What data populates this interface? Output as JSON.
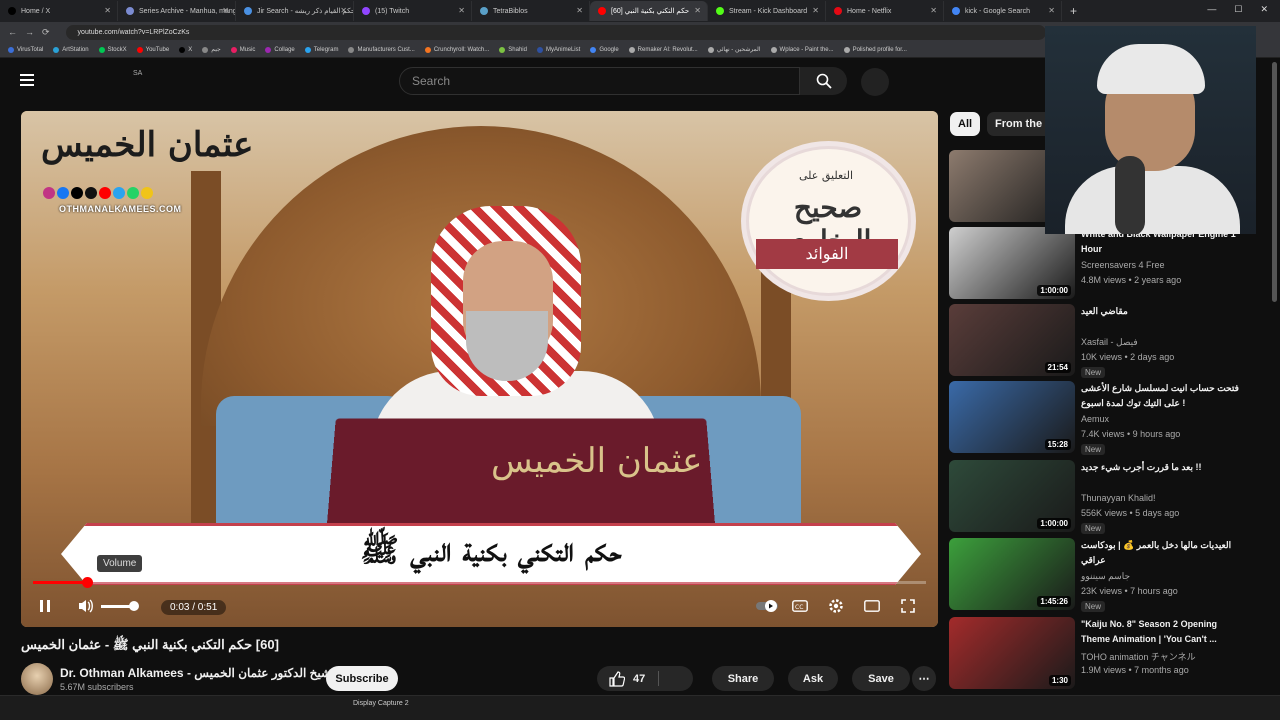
{
  "browser": {
    "tabs": [
      {
        "label": "Home / X",
        "color": "#000000"
      },
      {
        "label": "Series Archive - Manhua, mang",
        "color": "#7b8bd1"
      },
      {
        "label": "Jir Search - حكم القيام ذكر ريشه",
        "color": "#4a90e2"
      },
      {
        "label": "(15) Twitch",
        "color": "#9146ff"
      },
      {
        "label": "TetraBiblos",
        "color": "#5aa0c8"
      },
      {
        "label": "حكم التكني بكنية النبي [60]",
        "color": "#ff0000",
        "active": true
      },
      {
        "label": "Stream - Kick Dashboard",
        "color": "#53fc18"
      },
      {
        "label": "Home - Netflix",
        "color": "#e50914"
      },
      {
        "label": "kick - Google Search",
        "color": "#4285f4"
      }
    ],
    "new_tab": "+",
    "url": "youtube.com/watch?v=LRPlZoCzKs",
    "bookmarks": [
      "VirusTotal",
      "ArtStation",
      "StockX",
      "YouTube",
      "X",
      "جيم",
      "Music",
      "Collage",
      "Telegram",
      "Manufacturers Cust...",
      "Crunchyroll: Watch...",
      "Shahid",
      "MyAnimeList",
      "Google",
      "Remaker AI: Revolut...",
      "المرشحين - نهائي",
      "Wplace - Paint the...",
      "Polished profile for..."
    ]
  },
  "header": {
    "country": "SA",
    "search_placeholder": "Search"
  },
  "video": {
    "logo_text": "عثمان الخميس",
    "logo_url": "OTHMANALKAMEES.COM",
    "badge_small": "التعليق على",
    "badge_title": "صحيح البخاري",
    "badge_ribbon": "الفوائد",
    "book_text": "عثمان الخميس",
    "lower_third": "حكم التكني بكنية النبي ﷺ",
    "tooltip": "Volume",
    "time": "0:03 / 0:51",
    "progress_percent": 6
  },
  "meta": {
    "title": "[60] حكم التكني بكنية النبي ﷺ - عثمان الخميس",
    "channel": "Dr. Othman Alkamees - الشيخ الدكتور عثمان الخميس",
    "subscribers": "5.67M subscribers",
    "subscribe": "Subscribe",
    "likes": "47",
    "share": "Share",
    "ask": "Ask",
    "save": "Save"
  },
  "chips": {
    "all": "All",
    "from": "From the s"
  },
  "recommendations": [
    {
      "title": "",
      "channel": "",
      "meta": "",
      "duration": "",
      "thumb": "#8d7b6e"
    },
    {
      "title": "White and Black Wallpaper Engine 1 Hour",
      "channel": "Screensavers 4 Free",
      "meta": "4.8M views • 2 years ago",
      "duration": "1:00:00",
      "thumb": "#cfcfcf"
    },
    {
      "title": "مقاضي العيد",
      "channel": "Xasfail - فيصل",
      "meta": "10K views • 2 days ago",
      "duration": "21:54",
      "badge": "New",
      "thumb": "#5a3d3a"
    },
    {
      "title": "فتحت حساب انيت لمسلسل شارع الأعشى على التيك توك لمدة اسبوع !",
      "channel": "Aemux",
      "meta": "7.4K views • 9 hours ago",
      "duration": "15:28",
      "badge": "New",
      "thumb": "#3a6aa8"
    },
    {
      "title": "بعد ما قررت أجرب شيء جديد !!",
      "channel": "Thunayyan Khalid!",
      "meta": "556K views • 5 days ago",
      "duration": "1:00:00",
      "badge": "New",
      "thumb": "#2e4a3a"
    },
    {
      "title": "العيديات مالها دخل بالعمر 💰 | بودكاست عراقي",
      "channel": "جاسم سيننوو",
      "meta": "23K views • 7 hours ago",
      "duration": "1:45:26",
      "badge": "New",
      "thumb": "#3ca03c"
    },
    {
      "title": "\"Kaiju No. 8\" Season 2 Opening Theme Animation | 'You Can't ...",
      "channel": "TOHO animation チャンネル",
      "meta": "1.9M views • 7 months ago",
      "duration": "1:30",
      "thumb": "#a32b2b"
    }
  ],
  "taskbar": {
    "label": "Display Capture 2"
  }
}
